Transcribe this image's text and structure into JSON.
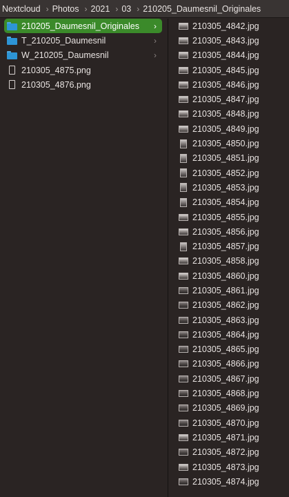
{
  "breadcrumb": [
    "Nextcloud",
    "Photos",
    "2021",
    "03",
    "210205_Daumesnil_Originales"
  ],
  "breadcrumb_separator": "›",
  "left_column": {
    "items": [
      {
        "label": "210205_Daumesnil_Originales",
        "type": "folder",
        "selected": true,
        "has_children": true
      },
      {
        "label": "T_210205_Daumesnil",
        "type": "folder",
        "selected": false,
        "has_children": true
      },
      {
        "label": "W_210205_Daumesnil",
        "type": "folder",
        "selected": false,
        "has_children": true
      },
      {
        "label": "210305_4875.png",
        "type": "file",
        "selected": false,
        "has_children": false
      },
      {
        "label": "210305_4876.png",
        "type": "file",
        "selected": false,
        "has_children": false
      }
    ],
    "chevron": "›"
  },
  "right_column": {
    "items": [
      {
        "label": "210305_4842.jpg",
        "thumb": "landscape"
      },
      {
        "label": "210305_4843.jpg",
        "thumb": "landscape"
      },
      {
        "label": "210305_4844.jpg",
        "thumb": "landscape"
      },
      {
        "label": "210305_4845.jpg",
        "thumb": "landscape"
      },
      {
        "label": "210305_4846.jpg",
        "thumb": "landscape"
      },
      {
        "label": "210305_4847.jpg",
        "thumb": "landscape"
      },
      {
        "label": "210305_4848.jpg",
        "thumb": "landscape"
      },
      {
        "label": "210305_4849.jpg",
        "thumb": "landscape"
      },
      {
        "label": "210305_4850.jpg",
        "thumb": "portrait"
      },
      {
        "label": "210305_4851.jpg",
        "thumb": "portrait"
      },
      {
        "label": "210305_4852.jpg",
        "thumb": "portrait"
      },
      {
        "label": "210305_4853.jpg",
        "thumb": "portrait"
      },
      {
        "label": "210305_4854.jpg",
        "thumb": "portrait"
      },
      {
        "label": "210305_4855.jpg",
        "thumb": "landscape"
      },
      {
        "label": "210305_4856.jpg",
        "thumb": "landscape"
      },
      {
        "label": "210305_4857.jpg",
        "thumb": "portrait"
      },
      {
        "label": "210305_4858.jpg",
        "thumb": "landscape"
      },
      {
        "label": "210305_4860.jpg",
        "thumb": "landscape"
      },
      {
        "label": "210305_4861.jpg",
        "thumb": "dark"
      },
      {
        "label": "210305_4862.jpg",
        "thumb": "dark"
      },
      {
        "label": "210305_4863.jpg",
        "thumb": "dark"
      },
      {
        "label": "210305_4864.jpg",
        "thumb": "dark"
      },
      {
        "label": "210305_4865.jpg",
        "thumb": "dark"
      },
      {
        "label": "210305_4866.jpg",
        "thumb": "dark"
      },
      {
        "label": "210305_4867.jpg",
        "thumb": "dark"
      },
      {
        "label": "210305_4868.jpg",
        "thumb": "dark"
      },
      {
        "label": "210305_4869.jpg",
        "thumb": "dark"
      },
      {
        "label": "210305_4870.jpg",
        "thumb": "dark"
      },
      {
        "label": "210305_4871.jpg",
        "thumb": "landscape"
      },
      {
        "label": "210305_4872.jpg",
        "thumb": "dark"
      },
      {
        "label": "210305_4873.jpg",
        "thumb": "landscape"
      },
      {
        "label": "210305_4874.jpg",
        "thumb": "dark"
      }
    ]
  },
  "colors": {
    "background": "#2a2423",
    "pathbar": "#393433",
    "selection": "#3b8a2a",
    "folder": "#2d95d6",
    "text": "#e8e3e1"
  }
}
